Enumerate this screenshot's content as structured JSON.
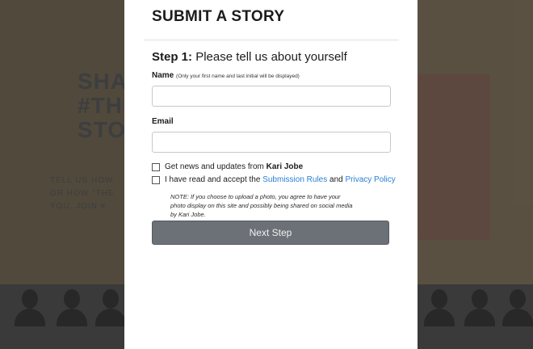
{
  "background": {
    "headline_lines": [
      "SHA",
      "#THE",
      "STOR"
    ],
    "sub_lines": [
      "TELL US HOW",
      "OR HOW \"THE",
      "YOU. JOIN #"
    ]
  },
  "modal": {
    "title": "SUBMIT A STORY",
    "step_label": "Step 1:",
    "step_text": "Please tell us about yourself",
    "name_label": "Name",
    "name_hint": "(Only your first name and last initial will be displayed)",
    "email_label": "Email",
    "news_checkbox": {
      "text": "Get news and updates from",
      "brand": "Kari Jobe",
      "checked": false
    },
    "rules_checkbox": {
      "text_before": "I have read and accept the",
      "link_rules": "Submission Rules",
      "text_and": "and",
      "link_privacy": "Privacy Policy",
      "checked": false
    },
    "note": "NOTE: If you choose to upload a photo, you agree to have your photo display on this site and possibly being shared on social media by Kari Jobe.",
    "next_button": "Next Step"
  },
  "colors": {
    "link": "#2a7fd4",
    "button_bg": "#6c7177"
  }
}
